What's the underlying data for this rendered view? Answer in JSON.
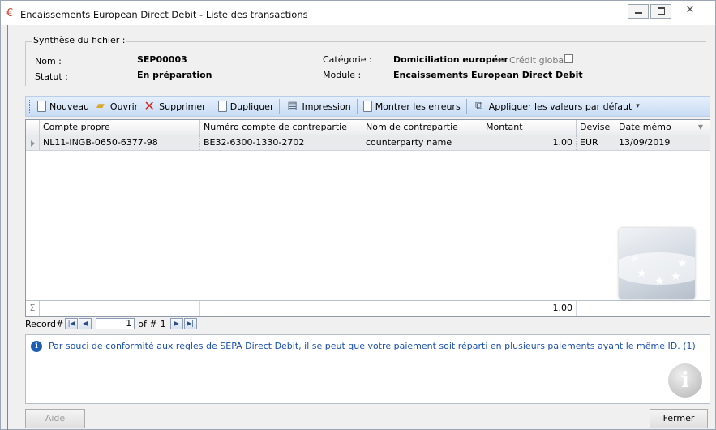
{
  "window": {
    "title": "Encaissements European Direct Debit - Liste des transactions",
    "icon": "euro-icon",
    "controls": [
      "minimize",
      "maximize",
      "close"
    ]
  },
  "summary": {
    "legend": "Synthèse du fichier :",
    "nom_label": "Nom :",
    "nom_value": "SEP00003",
    "statut_label": "Statut :",
    "statut_value": "En préparation",
    "categorie_label": "Catégorie :",
    "categorie_value": "Domiciliation européenne",
    "credit_global_label": "Crédit global",
    "credit_global_checked": false,
    "module_label": "Module :",
    "module_value": "Encaissements European Direct Debit"
  },
  "toolbar": {
    "nouveau": "Nouveau",
    "ouvrir": "Ouvrir",
    "supprimer": "Supprimer",
    "dupliquer": "Dupliquer",
    "impression": "Impression",
    "montrer_erreurs": "Montrer les erreurs",
    "appliquer_defaut": "Appliquer les valeurs par défaut"
  },
  "grid": {
    "columns": [
      "Compte propre",
      "Numéro compte de contrepartie",
      "Nom de contrepartie",
      "Montant",
      "Devise",
      "Date mémo"
    ],
    "rows": [
      {
        "compte_propre": "NL11-INGB-0650-6377-98",
        "numero_contrepartie": "BE32-6300-1330-2702",
        "nom_contrepartie": "counterparty name",
        "montant": "1.00",
        "devise": "EUR",
        "date_memo": "13/09/2019"
      }
    ],
    "footer_sigma": "Σ",
    "footer_total": "1.00"
  },
  "navigator": {
    "label": "Record#",
    "current": "1",
    "of_label": "of #",
    "total": "1"
  },
  "info": {
    "message": "Par souci de conformité aux règles de SEPA Direct Debit, il se peut que votre paiement soit réparti en plusieurs paiements ayant le même ID. (1)"
  },
  "buttons": {
    "aide": "Aide",
    "fermer": "Fermer"
  }
}
